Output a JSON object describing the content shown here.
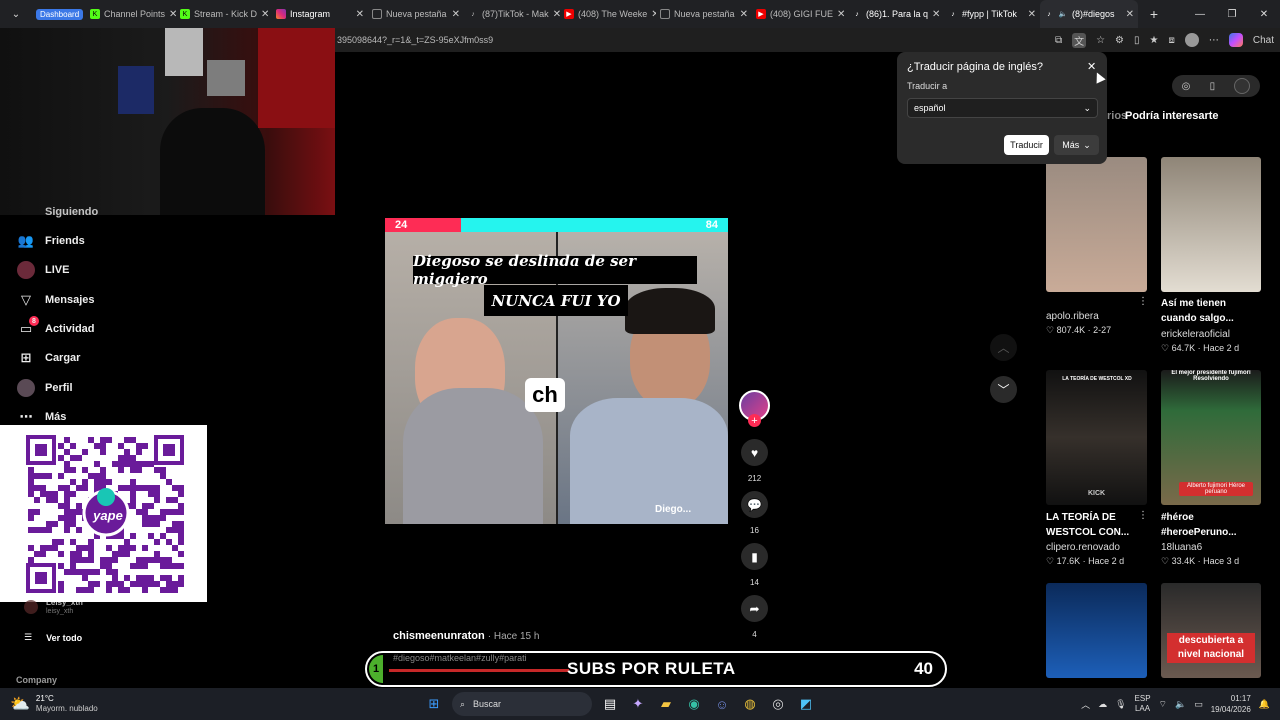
{
  "browser": {
    "tabs": [
      {
        "label": "Dashboard",
        "icon": "dashboard-icon",
        "active": false
      },
      {
        "label": "Channel Points",
        "icon": "kick-icon"
      },
      {
        "label": "Stream - Kick D",
        "icon": "kick-icon"
      },
      {
        "label": "Instagram",
        "icon": "instagram-icon"
      },
      {
        "label": "Nueva pestaña",
        "icon": "page-icon"
      },
      {
        "label": "(87)TikTok - Mak",
        "icon": "tiktok-icon"
      },
      {
        "label": "(408) The Weeke",
        "icon": "youtube-icon"
      },
      {
        "label": "Nueva pestaña",
        "icon": "page-icon"
      },
      {
        "label": "(408) GIGI FUE",
        "icon": "youtube-icon"
      },
      {
        "label": "(86)1. Para la q",
        "icon": "tiktok-icon"
      },
      {
        "label": "#fypp | TikTok",
        "icon": "tiktok-icon"
      },
      {
        "label": "(8)#diegos",
        "icon": "tiktok-icon",
        "active": true
      }
    ],
    "url": "395098644?_r=1&_t=ZS-95eXJfm0ss9",
    "chat_label": "Chat"
  },
  "sidebar": {
    "partial_top": "Siguiendo",
    "items": [
      {
        "label": "Friends",
        "icon": "friends-icon"
      },
      {
        "label": "LIVE",
        "icon": "live-icon"
      },
      {
        "label": "Mensajes",
        "icon": "messages-icon"
      },
      {
        "label": "Actividad",
        "icon": "activity-icon",
        "badge": "8"
      },
      {
        "label": "Cargar",
        "icon": "upload-icon"
      },
      {
        "label": "Perfil",
        "icon": "profile-icon"
      },
      {
        "label": "Más",
        "icon": "more-icon"
      }
    ],
    "following_user": {
      "name": "Leisy_xth",
      "handle": "leisy_xth"
    },
    "see_all": "Ver todo",
    "company": "Company"
  },
  "qr": {
    "brand": "yape"
  },
  "video": {
    "score_left": "24",
    "score_right": "84",
    "caption_line1": "Diegoso se deslinda de ser migajero",
    "caption_line2": "NUNCA FUI YO",
    "watermark": "Diego...",
    "author": "chismeenunraton",
    "time": "· Hace 15 h",
    "hashtags": "#diegoso#matkeelan#zully#parati"
  },
  "actions": {
    "likes": "212",
    "comments": "16",
    "saves": "14",
    "shares": "4"
  },
  "overlay": {
    "left_number": "1",
    "label": "SUBS POR RULETA",
    "right_number": "40"
  },
  "translate_popup": {
    "title": "¿Traducir página de inglés?",
    "to_label": "Traducir a",
    "language": "español",
    "translate_button": "Traducir",
    "more_button": "Más"
  },
  "feed": {
    "tab_partial": "rios",
    "tab": "Podría interesarte",
    "items": [
      {
        "author": "apolo.ribera",
        "stats": "807.4K · 2-27",
        "title": ""
      },
      {
        "title": "Así me tienen cuando salgo...",
        "author": "erickeleraoficial",
        "stats": "64.7K · Hace 2 d"
      },
      {
        "title": "LA TEORÍA DE WESTCOL CON...",
        "author": "clipero.renovado",
        "stats": "17.6K · Hace 2 d",
        "thumb_top": "LA TEORÍA DE WESTCOL XD",
        "thumb_bottom": "KICK"
      },
      {
        "title": "#héroe #heroePeruno...",
        "author": "18luana6",
        "stats": "33.4K · Hace 3 d",
        "thumb_top": "El mejor presidente fujimori Resolviendo",
        "thumb_bottom": "Alberto fujimori Héroe peruano"
      },
      {
        "thumb_text": "descubierta a nivel nacional"
      }
    ]
  },
  "taskbar": {
    "weather_temp": "21°C",
    "weather_desc": "Mayorm. nublado",
    "search": "Buscar",
    "lang": "ESP",
    "lang2": "LAA",
    "time": "01:17",
    "date": "19/04/2026"
  },
  "colors": {
    "tiktok_red": "#fe2c55",
    "tiktok_cyan": "#25f4ee",
    "chrome_blue": "#3b78e7",
    "yape_purple": "#6a1b9a"
  }
}
